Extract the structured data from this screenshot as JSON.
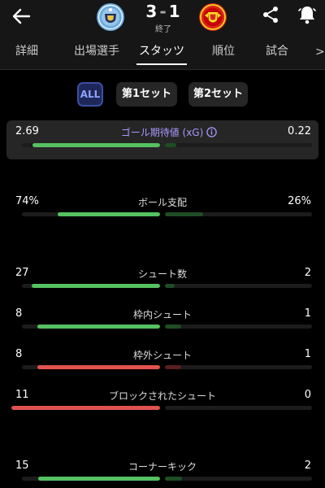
{
  "match": {
    "home_score": "3",
    "separator": "-",
    "away_score": "1",
    "status": "終了"
  },
  "tabs": [
    {
      "label": "詳細",
      "active": false
    },
    {
      "label": "出場選手",
      "active": false
    },
    {
      "label": "スタッツ",
      "active": true
    },
    {
      "label": "順位",
      "active": false
    },
    {
      "label": "試合",
      "active": false
    }
  ],
  "tabs_more": ">",
  "segments": [
    {
      "label": "ALL",
      "active": true
    },
    {
      "label": "第1セット",
      "active": false
    },
    {
      "label": "第2セット",
      "active": false
    }
  ],
  "stats": [
    {
      "label": "ゴール期待値 (xG)",
      "home": "2.69",
      "away": "0.22",
      "home_fraction": 0.924,
      "away_fraction": 0.076,
      "bar_style": "green",
      "highlight": true
    },
    {
      "label": "ボール支配",
      "home": "74%",
      "away": "26%",
      "home_fraction": 0.74,
      "away_fraction": 0.26,
      "bar_style": "green"
    },
    {
      "label": "シュート数",
      "home": "27",
      "away": "2",
      "home_fraction": 0.931,
      "away_fraction": 0.069,
      "bar_style": "green"
    },
    {
      "label": "枠内シュート",
      "home": "8",
      "away": "1",
      "home_fraction": 0.889,
      "away_fraction": 0.111,
      "bar_style": "green"
    },
    {
      "label": "枠外シュート",
      "home": "8",
      "away": "1",
      "home_fraction": 0.889,
      "away_fraction": 0.111,
      "bar_style": "red"
    },
    {
      "label": "ブロックされたシュート",
      "home": "11",
      "away": "0",
      "home_fraction": 1.0,
      "away_fraction": 0.0,
      "bar_style": "red"
    },
    {
      "label": "コーナーキック",
      "home": "15",
      "away": "2",
      "home_fraction": 0.882,
      "away_fraction": 0.118,
      "bar_style": "green"
    }
  ],
  "colors": {
    "header_bg": "#161616",
    "accent_purple": "#a999ff",
    "bar_green": "#55c161",
    "bar_red": "#e2534d"
  },
  "icons": [
    "back-arrow-icon",
    "man-city-crest-icon",
    "man-united-crest-icon",
    "share-icon",
    "bell-icon",
    "info-icon"
  ]
}
